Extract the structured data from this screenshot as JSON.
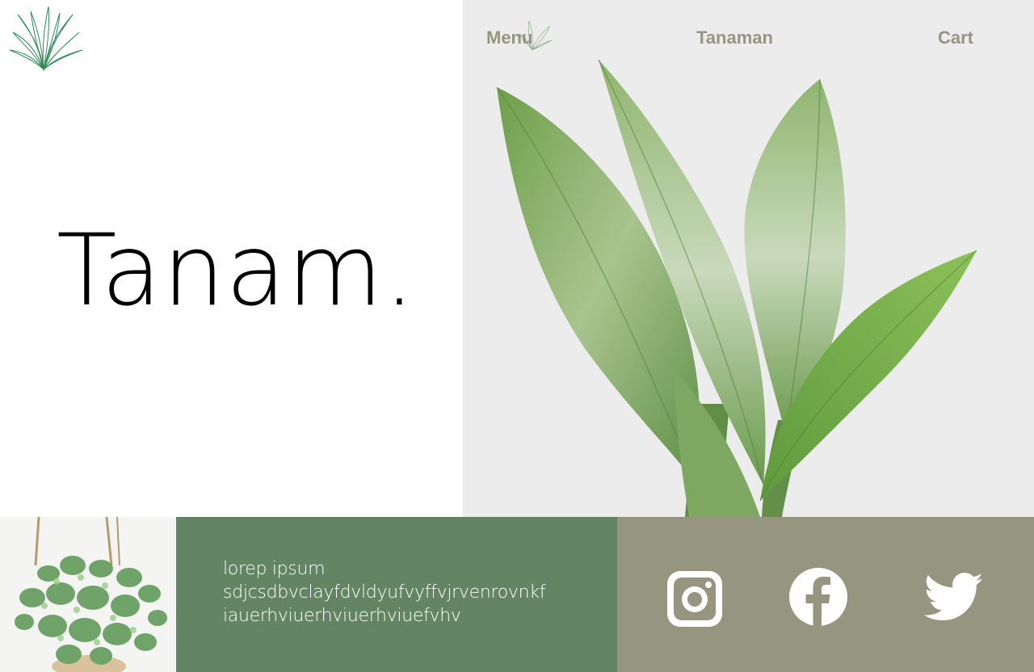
{
  "brand": {
    "title": "Tanam."
  },
  "nav": {
    "menu": "Menu",
    "tanaman": "Tanaman",
    "cart": "Cart"
  },
  "footer": {
    "description_lines": [
      "lorep ipsum",
      "sdjcsdbvclayfdvldyufvyffvjrvenrovnkf",
      "iauerhviuerhviuerhviuefvhv"
    ],
    "social": [
      "instagram-icon",
      "facebook-icon",
      "twitter-icon"
    ]
  },
  "colors": {
    "hero_right_bg": "#ececec",
    "nav_text": "#969580",
    "green_panel": "#638563",
    "social_panel": "#969580",
    "logo_stroke": "#2e8b57"
  }
}
